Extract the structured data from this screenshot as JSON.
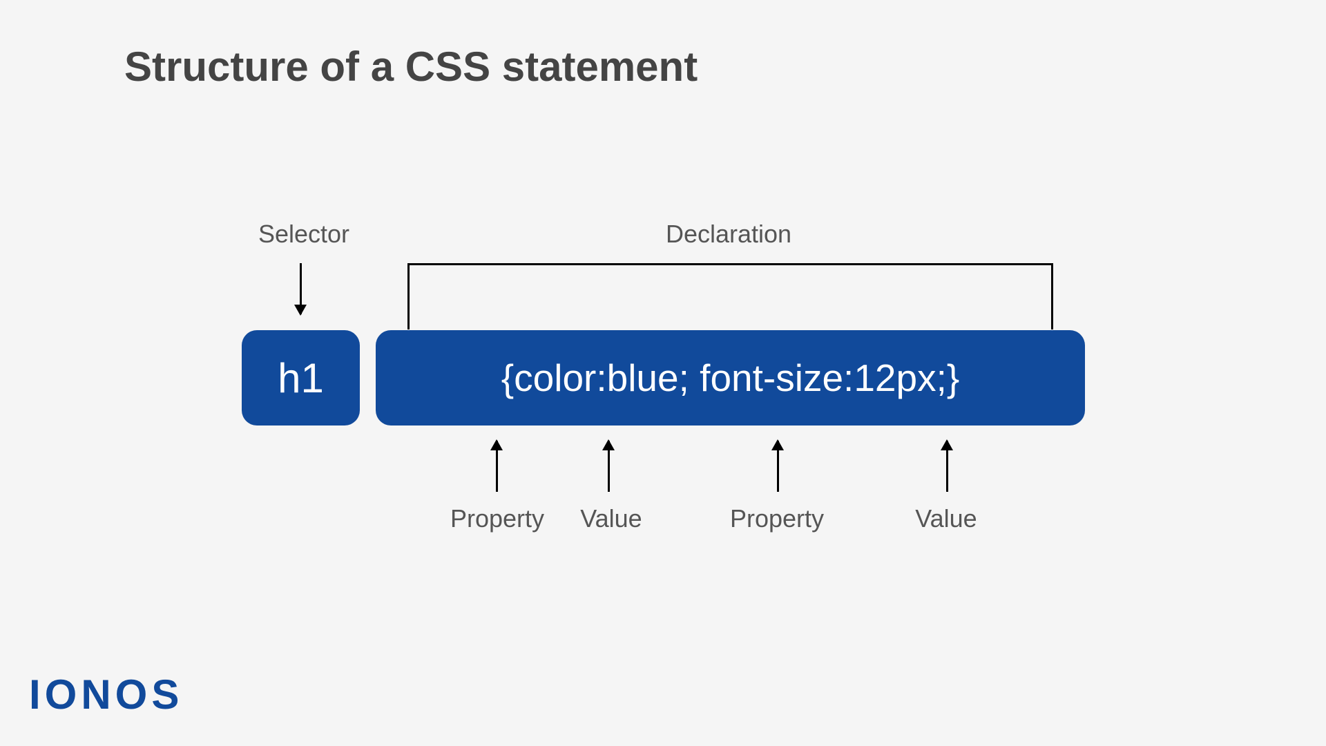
{
  "title": "Structure of a CSS statement",
  "labels": {
    "selector": "Selector",
    "declaration": "Declaration",
    "property1": "Property",
    "value1": "Value",
    "property2": "Property",
    "value2": "Value"
  },
  "boxes": {
    "selector": "h1",
    "declaration": "{color:blue; font-size:12px;}"
  },
  "brand": "IONOS"
}
